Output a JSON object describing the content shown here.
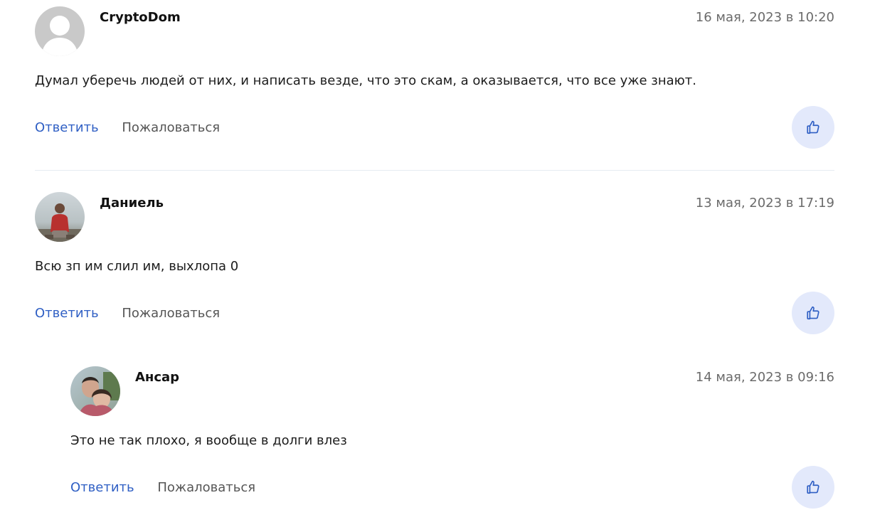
{
  "comments": [
    {
      "author": "CryptoDom",
      "date": "16 мая, 2023 в 10:20",
      "text": "Думал уберечь людей от них, и написать везде, что это скам, а оказывается, что все уже знают.",
      "reply_label": "Ответить",
      "report_label": "Пожаловаться",
      "avatar_icon": "default-user-icon"
    },
    {
      "author": "Даниель",
      "date": "13 мая, 2023 в 17:19",
      "text": "Всю зп им слил им, выхлопа 0",
      "reply_label": "Ответить",
      "report_label": "Пожаловаться",
      "avatar_icon": "user-photo"
    },
    {
      "author": "Ансар",
      "date": "14 мая, 2023 в 09:16",
      "text": "Это не так плохо, я вообще в долги влез",
      "reply_label": "Ответить",
      "report_label": "Пожаловаться",
      "avatar_icon": "user-photo",
      "is_reply": true
    }
  ],
  "colors": {
    "link": "#2f5fc4",
    "like_bg": "#e3e9fb",
    "like_icon": "#2f5fc4",
    "date": "#6b6b6b",
    "divider": "#e6ecf2"
  }
}
